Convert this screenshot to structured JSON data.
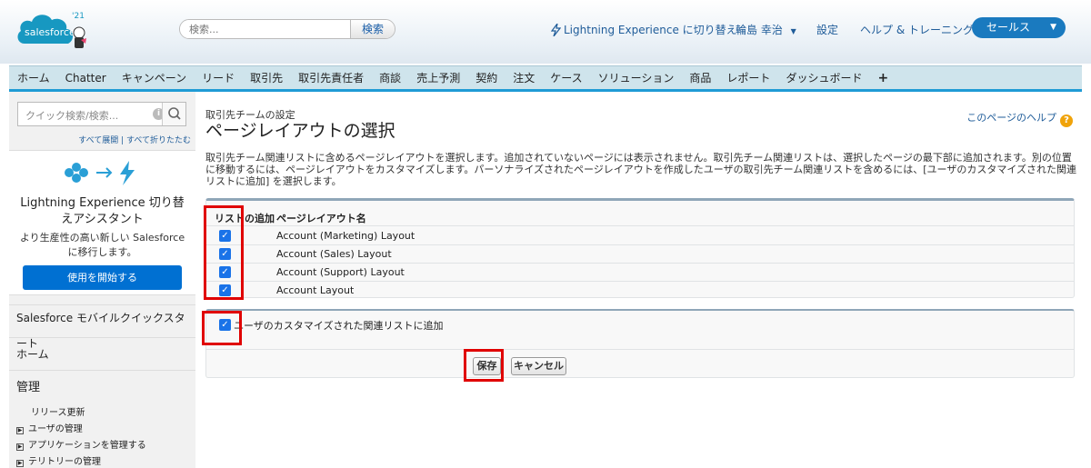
{
  "header": {
    "logo_text": "salesforce",
    "logo_year": "'21",
    "search": {
      "placeholder": "検索...",
      "button": "検索"
    },
    "links": {
      "lightning": "Lightning Experience に切り替え",
      "user": "輪島 幸治",
      "setup": "設定",
      "help": "ヘルプ & トレーニング"
    },
    "app_menu": "セールス"
  },
  "tabs": [
    "ホーム",
    "Chatter",
    "キャンペーン",
    "リード",
    "取引先",
    "取引先責任者",
    "商談",
    "売上予測",
    "契約",
    "注文",
    "ケース",
    "ソリューション",
    "商品",
    "レポート",
    "ダッシュボード",
    "+"
  ],
  "sidebar": {
    "quick_search_placeholder": "クイック検索/検索...",
    "expand_links": "すべて展開 | すべて折りたたむ",
    "lightning_card": {
      "title": "Lightning Experience 切り替えアシスタント",
      "subtitle": "より生産性の高い新しい Salesforce に移行します。",
      "button": "使用を開始する"
    },
    "mobile_quickstart": "Salesforce モバイルクイックスタート",
    "home": "ホーム",
    "admin": "管理",
    "links": [
      "リリース更新",
      "ユーザの管理",
      "アプリケーションを管理する",
      "テリトリーの管理"
    ]
  },
  "main": {
    "breadcrumb": "取引先チームの設定",
    "title": "ページレイアウトの選択",
    "help_link": "このページのヘルプ",
    "description": "取引先チーム関連リストに含めるページレイアウトを選択します。追加されていないページには表示されません。取引先チーム関連リストは、選択したページの最下部に追加されます。別の位置に移動するには、ページレイアウトをカスタマイズします。パーソナライズされたページレイアウトを作成したユーザの取引先チーム関連リストを含めるには、[ユーザのカスタマイズされた関連リストに追加] を選択します。",
    "table": {
      "col_add": "リストの追加",
      "col_name": "ページレイアウト名",
      "rows": [
        {
          "name": "Account (Marketing) Layout",
          "checked": true
        },
        {
          "name": "Account (Sales) Layout",
          "checked": true
        },
        {
          "name": "Account (Support) Layout",
          "checked": true
        },
        {
          "name": "Account Layout",
          "checked": true
        }
      ]
    },
    "add_to_custom_label": "ユーザのカスタマイズされた関連リストに追加",
    "add_to_custom_checked": true,
    "buttons": {
      "save": "保存",
      "cancel": "キャンセル"
    }
  },
  "colors": {
    "accent": "#1f9bd5",
    "brand": "#0070d2",
    "highlight": "#e00000"
  }
}
